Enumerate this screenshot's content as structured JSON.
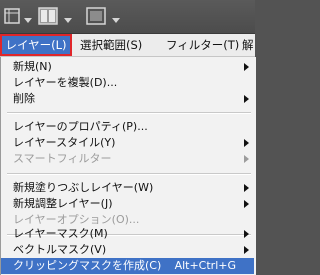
{
  "toolbar": {
    "icons": [
      "view-extras-icon",
      "arrange-documents-icon",
      "screen-mode-icon"
    ]
  },
  "menubar": {
    "items": [
      {
        "label": "レイヤー(L)"
      },
      {
        "label": "選択範囲(S)"
      },
      {
        "label": "フィルター(T)"
      },
      {
        "label": "解"
      }
    ]
  },
  "menu": {
    "items": [
      {
        "label": "新規(N)",
        "submenu": true
      },
      {
        "label": "レイヤーを複製(D)..."
      },
      {
        "label": "削除",
        "submenu": true
      },
      {
        "label": "レイヤーのプロパティ(P)..."
      },
      {
        "label": "レイヤースタイル(Y)",
        "submenu": true
      },
      {
        "label": "スマートフィルター",
        "submenu": true,
        "disabled": true
      },
      {
        "label": "新規塗りつぶしレイヤー(W)",
        "submenu": true
      },
      {
        "label": "新規調整レイヤー(J)",
        "submenu": true
      },
      {
        "label": "レイヤーオプション(O)...",
        "disabled": true
      },
      {
        "label": "レイヤーマスク(M)",
        "submenu": true
      },
      {
        "label": "ベクトルマスク(V)",
        "submenu": true
      },
      {
        "label": "クリッピングマスクを作成(C)",
        "shortcut": "Alt+Ctrl+G",
        "highlighted": true
      }
    ]
  },
  "colors": {
    "highlight": "#3f72c6",
    "focus_outline": "#e0262a",
    "toolbar_bg": "#535353",
    "menu_bg": "#f2f2f2"
  }
}
